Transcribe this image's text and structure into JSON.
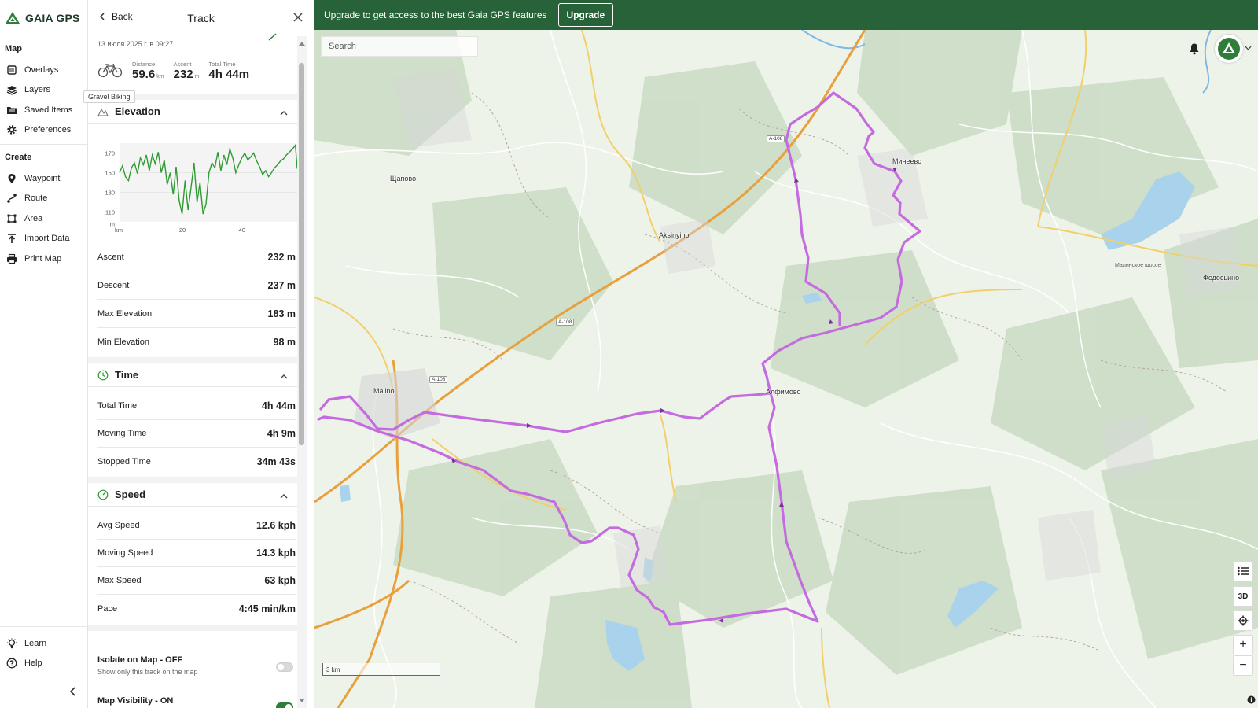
{
  "brand": {
    "name": "GAIA GPS"
  },
  "nav": {
    "map_section": "Map",
    "map_items": [
      {
        "label": "Overlays",
        "icon": "overlays-icon"
      },
      {
        "label": "Layers",
        "icon": "layers-icon"
      },
      {
        "label": "Saved Items",
        "icon": "folder-icon"
      },
      {
        "label": "Preferences",
        "icon": "gear-icon"
      }
    ],
    "create_section": "Create",
    "create_items": [
      {
        "label": "Waypoint",
        "icon": "pin-icon"
      },
      {
        "label": "Route",
        "icon": "route-icon"
      },
      {
        "label": "Area",
        "icon": "area-icon"
      },
      {
        "label": "Import Data",
        "icon": "upload-icon"
      },
      {
        "label": "Print Map",
        "icon": "printer-icon"
      }
    ],
    "bottom_items": [
      {
        "label": "Learn",
        "icon": "lightbulb-icon"
      },
      {
        "label": "Help",
        "icon": "help-icon"
      }
    ]
  },
  "tooltip": "Gravel Biking",
  "panel": {
    "back_label": "Back",
    "title": "Track",
    "date": "13 июля 2025 г. в 09:27",
    "summary": [
      {
        "label": "Distance",
        "value": "59.6",
        "unit": "km"
      },
      {
        "label": "Ascent",
        "value": "232",
        "unit": "m"
      },
      {
        "label": "Total Time",
        "value": "4h 44m",
        "unit": ""
      }
    ]
  },
  "elevation": {
    "title": "Elevation",
    "rows": [
      {
        "label": "Ascent",
        "value": "232 m"
      },
      {
        "label": "Descent",
        "value": "237 m"
      },
      {
        "label": "Max Elevation",
        "value": "183 m"
      },
      {
        "label": "Min Elevation",
        "value": "98 m"
      }
    ]
  },
  "time": {
    "title": "Time",
    "rows": [
      {
        "label": "Total Time",
        "value": "4h 44m"
      },
      {
        "label": "Moving Time",
        "value": "4h 9m"
      },
      {
        "label": "Stopped Time",
        "value": "34m 43s"
      }
    ]
  },
  "speed": {
    "title": "Speed",
    "rows": [
      {
        "label": "Avg Speed",
        "value": "12.6 kph"
      },
      {
        "label": "Moving Speed",
        "value": "14.3 kph"
      },
      {
        "label": "Max Speed",
        "value": "63 kph"
      },
      {
        "label": "Pace",
        "value": "4:45 min/km"
      }
    ]
  },
  "isolate": {
    "title": "Isolate on Map - OFF",
    "subtitle": "Show only this track on the map",
    "on": false
  },
  "visibility": {
    "title": "Map Visibility - ON",
    "on": true
  },
  "chart_data": {
    "type": "line",
    "y_ticks": [
      "170",
      "150",
      "130",
      "110",
      "m"
    ],
    "x_ticks": [
      "km",
      "20",
      "40"
    ],
    "ylim": [
      100,
      180
    ],
    "xlim": [
      0,
      59.6
    ],
    "color": "#2e9b33",
    "series": [
      {
        "values": [
          [
            0,
            150
          ],
          [
            1,
            157
          ],
          [
            2,
            146
          ],
          [
            3,
            142
          ],
          [
            4,
            155
          ],
          [
            5,
            160
          ],
          [
            6,
            149
          ],
          [
            7,
            165
          ],
          [
            8,
            158
          ],
          [
            9,
            168
          ],
          [
            10,
            152
          ],
          [
            11,
            168
          ],
          [
            12,
            159
          ],
          [
            13,
            171
          ],
          [
            14,
            150
          ],
          [
            15,
            163
          ],
          [
            16,
            138
          ],
          [
            17,
            150
          ],
          [
            18,
            128
          ],
          [
            19,
            156
          ],
          [
            20,
            122
          ],
          [
            21,
            108
          ],
          [
            22,
            142
          ],
          [
            23,
            112
          ],
          [
            24,
            135
          ],
          [
            25,
            160
          ],
          [
            26,
            120
          ],
          [
            27,
            140
          ],
          [
            28,
            108
          ],
          [
            29,
            118
          ],
          [
            30,
            150
          ],
          [
            31,
            160
          ],
          [
            32,
            155
          ],
          [
            33,
            171
          ],
          [
            34,
            152
          ],
          [
            35,
            168
          ],
          [
            36,
            158
          ],
          [
            37,
            174
          ],
          [
            38,
            165
          ],
          [
            39,
            150
          ],
          [
            40,
            158
          ],
          [
            41,
            165
          ],
          [
            42,
            170
          ],
          [
            43,
            163
          ],
          [
            44,
            166
          ],
          [
            45,
            170
          ],
          [
            46,
            162
          ],
          [
            47,
            156
          ],
          [
            48,
            148
          ],
          [
            49,
            152
          ],
          [
            50,
            146
          ],
          [
            51,
            150
          ],
          [
            52,
            155
          ],
          [
            53,
            158
          ],
          [
            54,
            162
          ],
          [
            55,
            164
          ],
          [
            56,
            168
          ],
          [
            57,
            171
          ],
          [
            58,
            174
          ],
          [
            59,
            178
          ],
          [
            59.6,
            154
          ]
        ]
      }
    ]
  },
  "banner": {
    "text": "Upgrade to get access to the best Gaia GPS features",
    "button": "Upgrade"
  },
  "map": {
    "search_placeholder": "Search",
    "labels": [
      "Минеево",
      "Щапово",
      "Aksinyino",
      "Malino",
      "Алфимово",
      "Федосьино",
      "Малинское шоссе"
    ],
    "road_shields": [
      "А-108",
      "А-108",
      "А-108"
    ],
    "scale": "3 km",
    "three_d": "3D",
    "zoom_in": "+",
    "zoom_out": "−",
    "track_color": "#c46be0"
  }
}
